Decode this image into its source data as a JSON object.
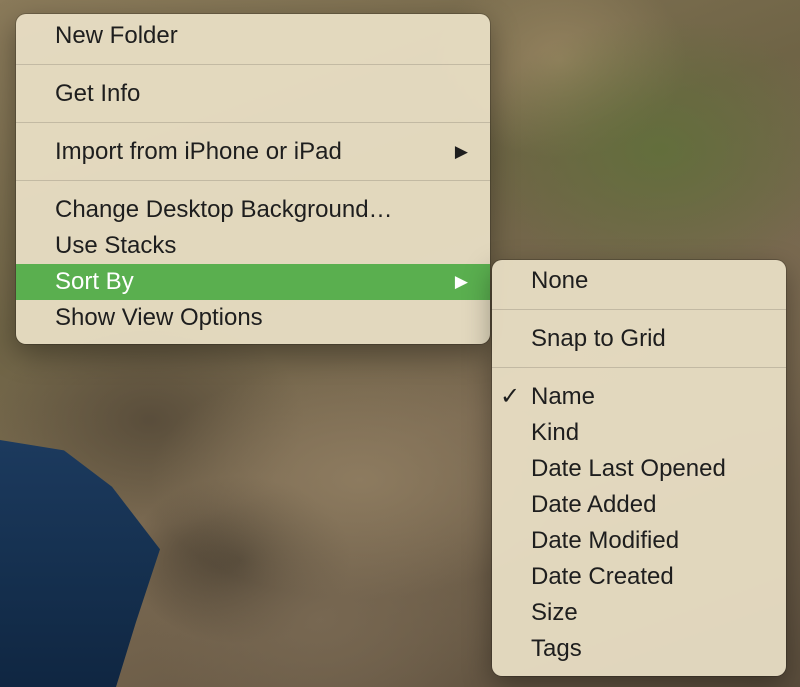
{
  "context_menu": {
    "items": [
      {
        "label": "New Folder"
      },
      {
        "label": "Get Info"
      },
      {
        "label": "Import from iPhone or iPad",
        "submenu_arrow": "▶"
      },
      {
        "label": "Change Desktop Background…"
      },
      {
        "label": "Use Stacks"
      },
      {
        "label": "Sort By",
        "submenu_arrow": "▶",
        "highlighted": true
      },
      {
        "label": "Show View Options"
      }
    ],
    "highlight_color": "#5aaf4f"
  },
  "sort_by_submenu": {
    "check_glyph": "✓",
    "items": [
      {
        "label": "None"
      },
      {
        "label": "Snap to Grid"
      },
      {
        "label": "Name",
        "checked": true
      },
      {
        "label": "Kind"
      },
      {
        "label": "Date Last Opened"
      },
      {
        "label": "Date Added"
      },
      {
        "label": "Date Modified"
      },
      {
        "label": "Date Created"
      },
      {
        "label": "Size"
      },
      {
        "label": "Tags"
      }
    ]
  },
  "icons": {
    "submenu_arrow": "chevron-right-icon",
    "checkmark": "checkmark-icon"
  }
}
